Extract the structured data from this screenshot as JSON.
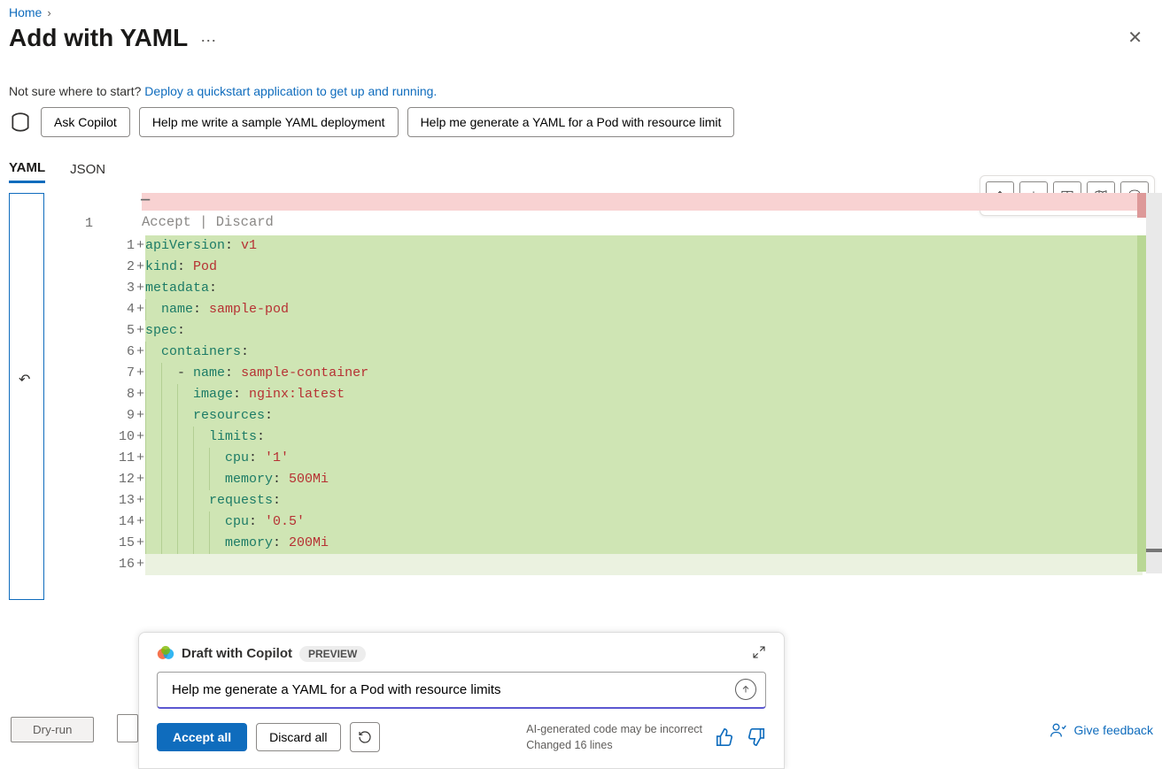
{
  "breadcrumb": {
    "home": "Home"
  },
  "title": "Add with YAML",
  "helpText": "Not sure where to start?  ",
  "helpLink": "Deploy a quickstart application to get up and running.",
  "chips": {
    "ask": "Ask Copilot",
    "sample": "Help me write a sample YAML deployment",
    "pod": "Help me generate a YAML for a Pod with resource limit"
  },
  "tabs": {
    "yaml": "YAML",
    "json": "JSON"
  },
  "editor": {
    "origLine": "1",
    "accept": "Accept",
    "discard": "Discard",
    "lines": [
      {
        "n": 1,
        "ind": 0,
        "tokens": [
          [
            "key",
            "apiVersion"
          ],
          [
            "col",
            ":"
          ],
          [
            "sp",
            " "
          ],
          [
            "val",
            "v1"
          ]
        ]
      },
      {
        "n": 2,
        "ind": 0,
        "tokens": [
          [
            "key",
            "kind"
          ],
          [
            "col",
            ":"
          ],
          [
            "sp",
            " "
          ],
          [
            "val",
            "Pod"
          ]
        ]
      },
      {
        "n": 3,
        "ind": 0,
        "tokens": [
          [
            "key",
            "metadata"
          ],
          [
            "col",
            ":"
          ]
        ]
      },
      {
        "n": 4,
        "ind": 1,
        "tokens": [
          [
            "key",
            "name"
          ],
          [
            "col",
            ":"
          ],
          [
            "sp",
            " "
          ],
          [
            "val",
            "sample-pod"
          ]
        ]
      },
      {
        "n": 5,
        "ind": 0,
        "tokens": [
          [
            "key",
            "spec"
          ],
          [
            "col",
            ":"
          ]
        ]
      },
      {
        "n": 6,
        "ind": 1,
        "tokens": [
          [
            "key",
            "containers"
          ],
          [
            "col",
            ":"
          ]
        ]
      },
      {
        "n": 7,
        "ind": 2,
        "tokens": [
          [
            "dash",
            "- "
          ],
          [
            "key",
            "name"
          ],
          [
            "col",
            ":"
          ],
          [
            "sp",
            " "
          ],
          [
            "val",
            "sample-container"
          ]
        ]
      },
      {
        "n": 8,
        "ind": 3,
        "tokens": [
          [
            "key",
            "image"
          ],
          [
            "col",
            ":"
          ],
          [
            "sp",
            " "
          ],
          [
            "val",
            "nginx:latest"
          ]
        ]
      },
      {
        "n": 9,
        "ind": 3,
        "tokens": [
          [
            "key",
            "resources"
          ],
          [
            "col",
            ":"
          ]
        ]
      },
      {
        "n": 10,
        "ind": 4,
        "tokens": [
          [
            "key",
            "limits"
          ],
          [
            "col",
            ":"
          ]
        ]
      },
      {
        "n": 11,
        "ind": 5,
        "tokens": [
          [
            "key",
            "cpu"
          ],
          [
            "col",
            ":"
          ],
          [
            "sp",
            " "
          ],
          [
            "val",
            "'1'"
          ]
        ]
      },
      {
        "n": 12,
        "ind": 5,
        "tokens": [
          [
            "key",
            "memory"
          ],
          [
            "col",
            ":"
          ],
          [
            "sp",
            " "
          ],
          [
            "val",
            "500Mi"
          ]
        ]
      },
      {
        "n": 13,
        "ind": 4,
        "tokens": [
          [
            "key",
            "requests"
          ],
          [
            "col",
            ":"
          ]
        ]
      },
      {
        "n": 14,
        "ind": 5,
        "tokens": [
          [
            "key",
            "cpu"
          ],
          [
            "col",
            ":"
          ],
          [
            "sp",
            " "
          ],
          [
            "val",
            "'0.5'"
          ]
        ]
      },
      {
        "n": 15,
        "ind": 5,
        "tokens": [
          [
            "key",
            "memory"
          ],
          [
            "col",
            ":"
          ],
          [
            "sp",
            " "
          ],
          [
            "val",
            "200Mi"
          ]
        ]
      },
      {
        "n": 16,
        "ind": 0,
        "tokens": []
      }
    ]
  },
  "footer": {
    "dryrun": "Dry-run",
    "feedback": "Give feedback"
  },
  "copilot": {
    "title": "Draft with Copilot",
    "badge": "PREVIEW",
    "input": "Help me generate a YAML for a Pod with resource limits",
    "acceptAll": "Accept all",
    "discardAll": "Discard all",
    "note1": "AI-generated code may be incorrect",
    "note2": "Changed 16 lines"
  }
}
